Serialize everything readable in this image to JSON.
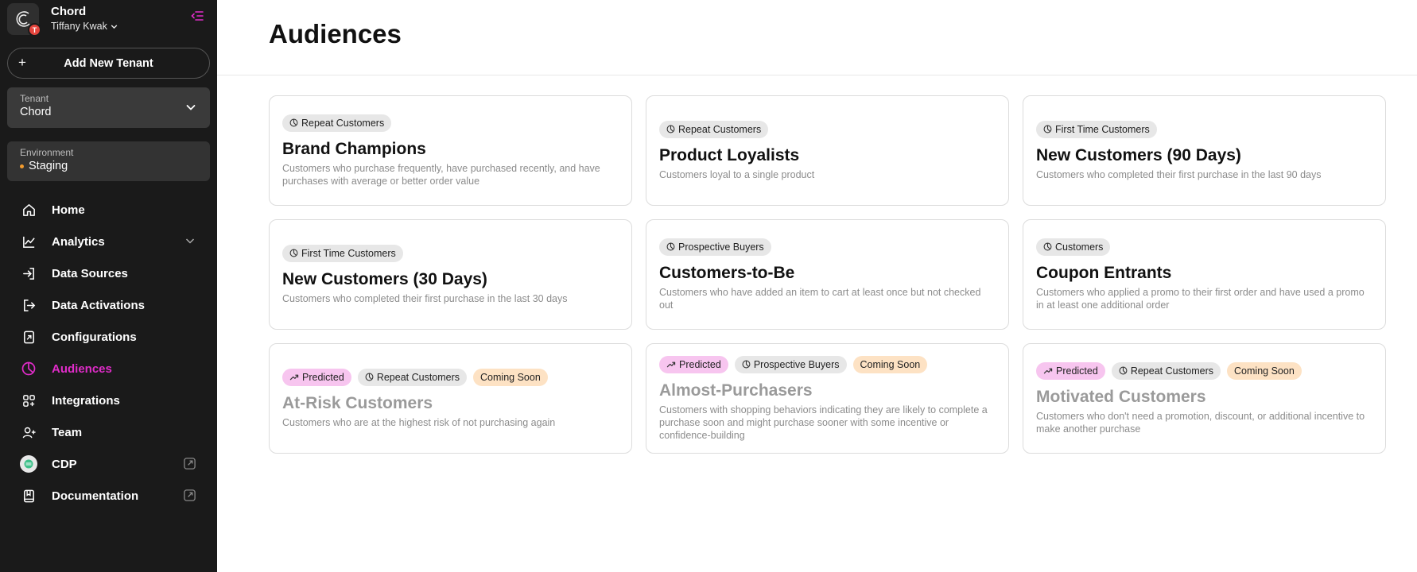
{
  "sidebar": {
    "brand_name": "Chord",
    "user_name": "Tiffany Kwak",
    "avatar_initial": "T",
    "add_tenant_label": "Add New Tenant",
    "tenant": {
      "label": "Tenant",
      "value": "Chord"
    },
    "environment": {
      "label": "Environment",
      "value": "Staging",
      "dot_color": "#f29b2e"
    },
    "nav": [
      {
        "label": "Home",
        "icon": "home-icon"
      },
      {
        "label": "Analytics",
        "icon": "chart-line-icon"
      },
      {
        "label": "Data Sources",
        "icon": "sign-in-icon"
      },
      {
        "label": "Data Activations",
        "icon": "sign-out-icon"
      },
      {
        "label": "Configurations",
        "icon": "file-icon"
      },
      {
        "label": "Audiences",
        "icon": "pie-icon",
        "active": true
      },
      {
        "label": "Integrations",
        "icon": "grid-plus-icon"
      },
      {
        "label": "Team",
        "icon": "user-plus-icon"
      },
      {
        "label": "CDP",
        "icon": "cdp-logo-icon"
      },
      {
        "label": "Documentation",
        "icon": "book-icon"
      }
    ],
    "active_color": "#e12cc9"
  },
  "main": {
    "title": "Audiences",
    "cards": [
      {
        "tags": [
          {
            "label": "Repeat Customers",
            "kind": "segment"
          }
        ],
        "title": "Brand Champions",
        "desc": "Customers who purchase frequently, have purchased recently, and have purchases with average or better order value",
        "dim": false
      },
      {
        "tags": [
          {
            "label": "Repeat Customers",
            "kind": "segment"
          }
        ],
        "title": "Product Loyalists",
        "desc": "Customers loyal to a single product",
        "dim": false
      },
      {
        "tags": [
          {
            "label": "First Time Customers",
            "kind": "segment"
          }
        ],
        "title": "New Customers (90 Days)",
        "desc": "Customers who completed their first purchase in the last 90 days",
        "dim": false
      },
      {
        "tags": [
          {
            "label": "First Time Customers",
            "kind": "segment"
          }
        ],
        "title": "New Customers (30 Days)",
        "desc": "Customers who completed their first purchase in the last 30 days",
        "dim": false
      },
      {
        "tags": [
          {
            "label": "Prospective Buyers",
            "kind": "segment"
          }
        ],
        "title": "Customers-to-Be",
        "desc": "Customers who have added an item to cart at least once but not checked out",
        "dim": false
      },
      {
        "tags": [
          {
            "label": "Customers",
            "kind": "segment"
          }
        ],
        "title": "Coupon Entrants",
        "desc": "Customers who applied a promo to their first order and have used a promo in at least one additional order",
        "dim": false
      },
      {
        "tags": [
          {
            "label": "Predicted",
            "kind": "pred"
          },
          {
            "label": "Repeat Customers",
            "kind": "segment"
          },
          {
            "label": "Coming Soon",
            "kind": "soon"
          }
        ],
        "title": "At-Risk Customers",
        "desc": "Customers who are at the highest risk of not purchasing again",
        "dim": true
      },
      {
        "tags": [
          {
            "label": "Predicted",
            "kind": "pred"
          },
          {
            "label": "Prospective Buyers",
            "kind": "segment"
          },
          {
            "label": "Coming Soon",
            "kind": "soon"
          }
        ],
        "title": "Almost-Purchasers",
        "desc": "Customers with shopping behaviors indicating they are likely to complete a purchase soon and might purchase sooner with some incentive or confidence-building",
        "dim": true
      },
      {
        "tags": [
          {
            "label": "Predicted",
            "kind": "pred"
          },
          {
            "label": "Repeat Customers",
            "kind": "segment"
          },
          {
            "label": "Coming Soon",
            "kind": "soon"
          }
        ],
        "title": "Motivated Customers",
        "desc": "Customers who don't need a promotion, discount, or additional incentive to make another purchase",
        "dim": true
      }
    ]
  }
}
